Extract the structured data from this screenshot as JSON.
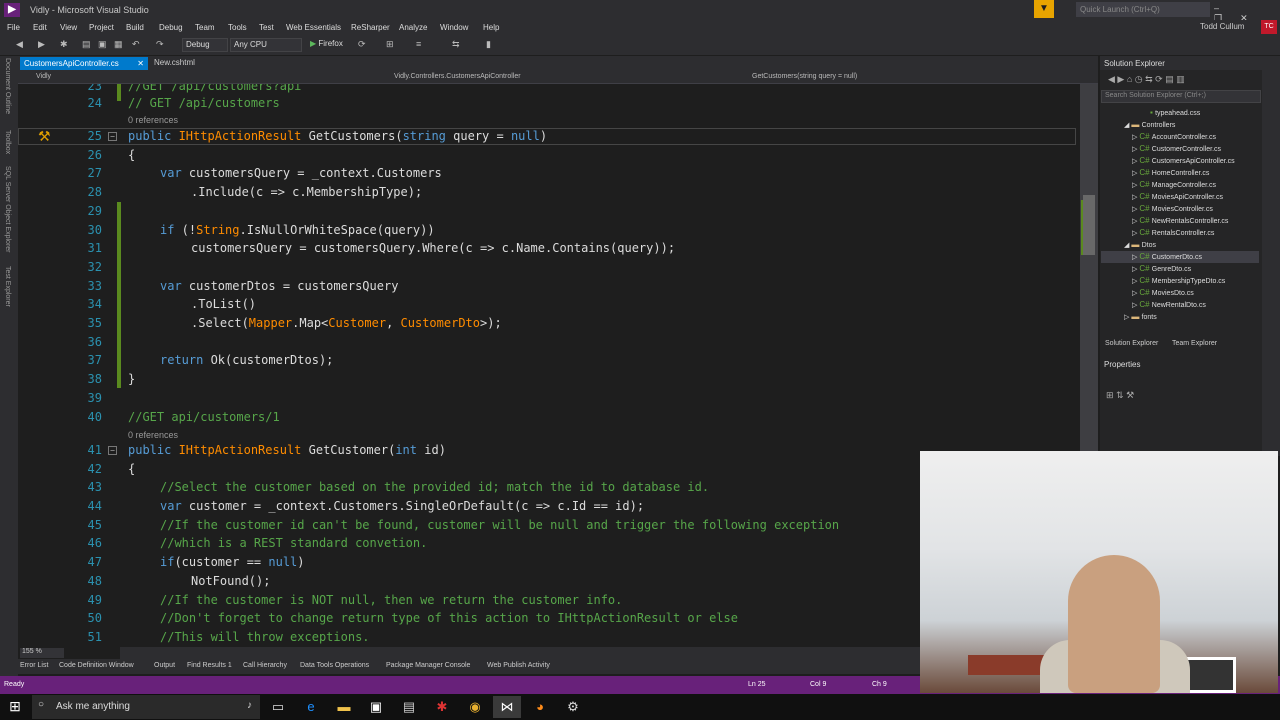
{
  "titlebar": {
    "title": "Vidly - Microsoft Visual Studio",
    "quick_launch": "Quick Launch (Ctrl+Q)",
    "user": "Todd Cullum",
    "user_initials": "TC"
  },
  "menu": [
    "File",
    "Edit",
    "View",
    "Project",
    "Build",
    "Debug",
    "Team",
    "Tools",
    "Test",
    "Web Essentials",
    "ReSharper",
    "Analyze",
    "Window",
    "Help"
  ],
  "toolbar": {
    "config": "Debug",
    "platform": "Any CPU",
    "run_target": "Firefox"
  },
  "left_rail": [
    "Document Outline",
    "Toolbox",
    "SQL Server Object Explorer",
    "Test Explorer"
  ],
  "tabs": [
    {
      "label": "CustomersApiController.cs"
    },
    {
      "label": "New.cshtml"
    }
  ],
  "navbar": {
    "project": "Vidly",
    "class": "Vidly.Controllers.CustomersApiController",
    "member": "GetCustomers(string query = null)"
  },
  "code": {
    "l23": {
      "n": "23",
      "t": "//GET /api/customers?api"
    },
    "l24": {
      "n": "24",
      "t": "// GET /api/customers"
    },
    "ref1": "0 references",
    "l25": {
      "n": "25",
      "kw": "public ",
      "ty": "IHttpActionResult",
      "rest": " GetCustomers(",
      "kw2": "string",
      "rest2": " query = ",
      "kw3": "null",
      "rest3": ")"
    },
    "l26": {
      "n": "26",
      "t": "{"
    },
    "l27": {
      "n": "27",
      "kw": "var",
      "rest": " customersQuery = _context.Customers"
    },
    "l28": {
      "n": "28",
      "t": ".Include(c => c.MembershipType);"
    },
    "l29": {
      "n": "29"
    },
    "l30": {
      "n": "30",
      "kw": "if",
      "rest": " (!",
      "ty": "String",
      "rest2": ".IsNullOrWhiteSpace(query))"
    },
    "l31": {
      "n": "31",
      "t": "customersQuery = customersQuery.Where(c => c.Name.Contains(query));"
    },
    "l32": {
      "n": "32"
    },
    "l33": {
      "n": "33",
      "kw": "var",
      "rest": " customerDtos = customersQuery"
    },
    "l34": {
      "n": "34",
      "t": ".ToList()"
    },
    "l35": {
      "n": "35",
      "a": ".Select(",
      "ty": "Mapper",
      "b": ".Map<",
      "ty2": "Customer",
      "c": ", ",
      "ty3": "CustomerDto",
      "d": ">);"
    },
    "l36": {
      "n": "36"
    },
    "l37": {
      "n": "37",
      "kw": "return",
      "rest": " Ok(customerDtos);"
    },
    "l38": {
      "n": "38",
      "t": "}"
    },
    "l39": {
      "n": "39"
    },
    "l40": {
      "n": "40",
      "t": "//GET api/customers/1"
    },
    "ref2": "0 references",
    "l41": {
      "n": "41",
      "kw": "public ",
      "ty": "IHttpActionResult",
      "rest": " GetCustomer(",
      "kw2": "int",
      "rest2": " id)"
    },
    "l42": {
      "n": "42",
      "t": "{"
    },
    "l43": {
      "n": "43",
      "t": "//Select the customer based on the provided id; match the id to database id."
    },
    "l44": {
      "n": "44",
      "kw": "var",
      "rest": " customer = _context.Customers.SingleOrDefault(c => c.Id == id);"
    },
    "l45": {
      "n": "45",
      "t": "//If the customer id can't be found, customer will be null and trigger the following exception"
    },
    "l46": {
      "n": "46",
      "t": "//which is a REST standard convetion."
    },
    "l47": {
      "n": "47",
      "kw": "if",
      "rest": "(customer == ",
      "kw2": "null",
      "rest2": ")"
    },
    "l48": {
      "n": "48",
      "t": "NotFound();"
    },
    "l49": {
      "n": "49",
      "t": "//If the customer is NOT null, then we return the customer info."
    },
    "l50": {
      "n": "50",
      "t": "//Don't forget to change return type of this action to IHttpActionResult or else"
    },
    "l51": {
      "n": "51",
      "t": "//This will throw exceptions."
    }
  },
  "zoom": "155 %",
  "bottom_tabs": [
    "Error List",
    "Code Definition Window",
    "Output",
    "Find Results 1",
    "Call Hierarchy",
    "Data Tools Operations",
    "Package Manager Console",
    "Web Publish Activity"
  ],
  "status": {
    "text": "Ready",
    "ln": "Ln 25",
    "col": "Col 9",
    "ch": "Ch 9"
  },
  "taskbar": {
    "search": "Ask me anything"
  },
  "solution_explorer": {
    "title": "Solution Explorer",
    "search": "Search Solution Explorer (Ctrl+;)",
    "items": [
      "typeahead.css",
      "Controllers",
      "AccountController.cs",
      "CustomerController.cs",
      "CustomersApiController.cs",
      "HomeController.cs",
      "ManageController.cs",
      "MoviesApiController.cs",
      "MoviesController.cs",
      "NewRentalsController.cs",
      "RentalsController.cs",
      "Dtos",
      "CustomerDto.cs",
      "GenreDto.cs",
      "MembershipTypeDto.cs",
      "MoviesDto.cs",
      "NewRentalDto.cs",
      "fonts"
    ],
    "tabs": [
      "Solution Explorer",
      "Team Explorer"
    ]
  },
  "properties": {
    "title": "Properties"
  }
}
